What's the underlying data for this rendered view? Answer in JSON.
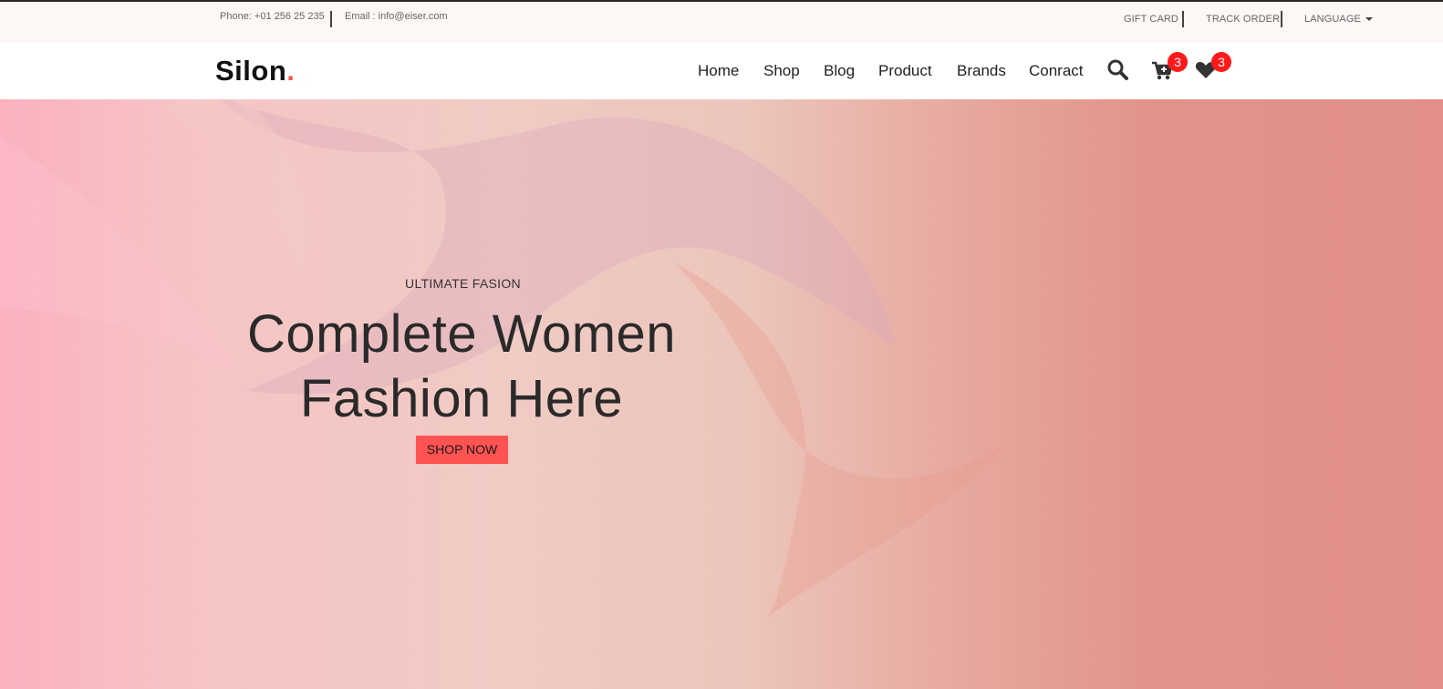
{
  "topbar": {
    "phone": "Phone: +01 256 25 235",
    "email": "Email : info@eiser.com",
    "links": {
      "gift_card": "GIFT CARD",
      "track_order": "TRACK ORDER",
      "language": "LANGUAGE"
    }
  },
  "navbar": {
    "logo_text": "Silon",
    "logo_dot": ".",
    "items": [
      "Home",
      "Shop",
      "Blog",
      "Product",
      "Brands",
      "Conract"
    ],
    "cart_count": "3",
    "wishlist_count": "3",
    "icons": {
      "search": "search-icon",
      "cart": "cart-icon",
      "wishlist": "heart-icon"
    }
  },
  "hero": {
    "subtitle": "ULTIMATE FASION",
    "title_line1": "Complete Women",
    "title_line2": "Fashion Here",
    "button": "SHOP NOW"
  },
  "colors": {
    "accent": "#ff5252",
    "badge": "#ff1a1a",
    "topbar_bg": "#fdf7f6"
  }
}
